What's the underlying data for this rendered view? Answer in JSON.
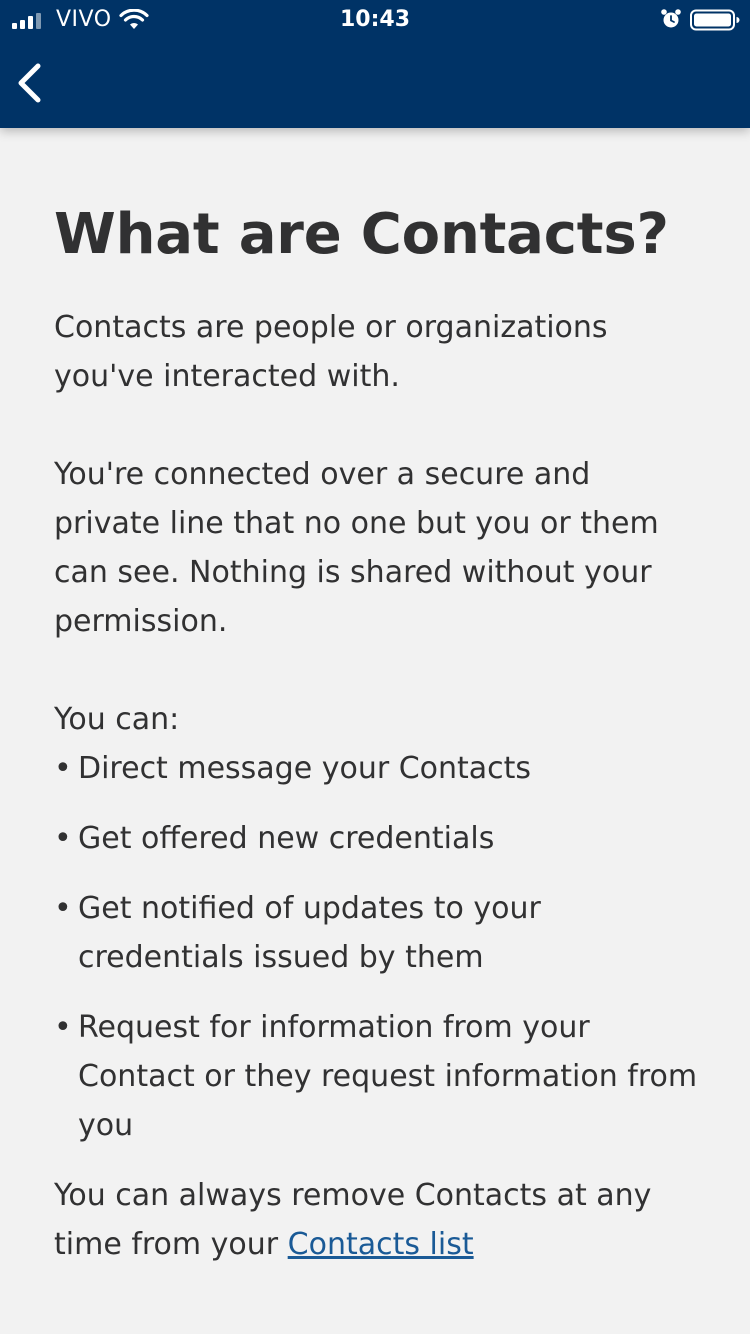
{
  "status_bar": {
    "carrier": "VIVO",
    "time": "10:43"
  },
  "header": {
    "back_icon": "chevron-left-icon",
    "background_color": "#003366"
  },
  "page": {
    "title": "What are Contacts?",
    "paragraph_1": "Contacts are people or organizations you've interacted with.",
    "paragraph_2": "You're connected over a secure and private line that no one but you or them can see. Nothing is shared without your permission.",
    "you_can_label": "You can:",
    "bullet_symbol": "•",
    "bullets": [
      "Direct message your Contacts",
      "Get offered new credentials",
      "Get notified of updates to your credentials issued by them",
      "Request for information from your Contact or they request information from you"
    ],
    "closing_text": "You can always remove Contacts at any time from your ",
    "contacts_link": "Contacts list",
    "link_color": "#1a5a96"
  }
}
